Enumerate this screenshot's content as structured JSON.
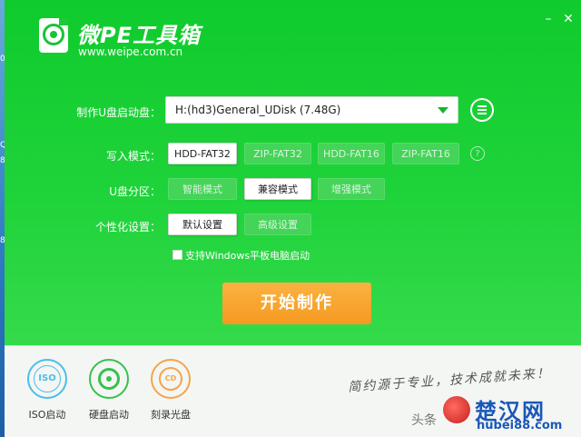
{
  "desktop": {
    "fragments": [
      "0",
      "Q",
      "8",
      "8"
    ]
  },
  "app": {
    "title": "微PE工具箱",
    "url": "www.weipe.com.cn",
    "controls": {
      "minimize": "–",
      "close": "✕"
    }
  },
  "form": {
    "boot_disk": {
      "label": "制作U盘启动盘：",
      "value": "H:(hd3)General_UDisk (7.48G)"
    },
    "write_mode": {
      "label": "写入模式：",
      "options": [
        "HDD-FAT32",
        "ZIP-FAT32",
        "HDD-FAT16",
        "ZIP-FAT16"
      ],
      "selected": "HDD-FAT32",
      "help": "?"
    },
    "partition": {
      "label": "U盘分区：",
      "options": [
        "智能模式",
        "兼容模式",
        "增强模式"
      ],
      "selected": "兼容模式"
    },
    "personalize": {
      "label": "个性化设置：",
      "options": [
        "默认设置",
        "高级设置"
      ],
      "selected": "默认设置"
    },
    "checkbox": {
      "label": "支持Windows平板电脑启动",
      "checked": false
    },
    "start_button": "开始制作"
  },
  "tools": [
    {
      "label": "ISO启动",
      "icon": "iso-disc-icon",
      "glyph": "ISO"
    },
    {
      "label": "硬盘启动",
      "icon": "hard-disk-icon",
      "glyph": ""
    },
    {
      "label": "刻录光盘",
      "icon": "burn-cd-icon",
      "glyph": "CD"
    }
  ],
  "slogan": "简约源于专业，技术成就未来！",
  "watermark": {
    "source": "头条",
    "site": "楚汉网",
    "url": "hubei88.com"
  },
  "colors": {
    "accent_green": "#1fd33a",
    "start_orange": "#f7a52f",
    "watermark_blue": "#1b58b8"
  }
}
